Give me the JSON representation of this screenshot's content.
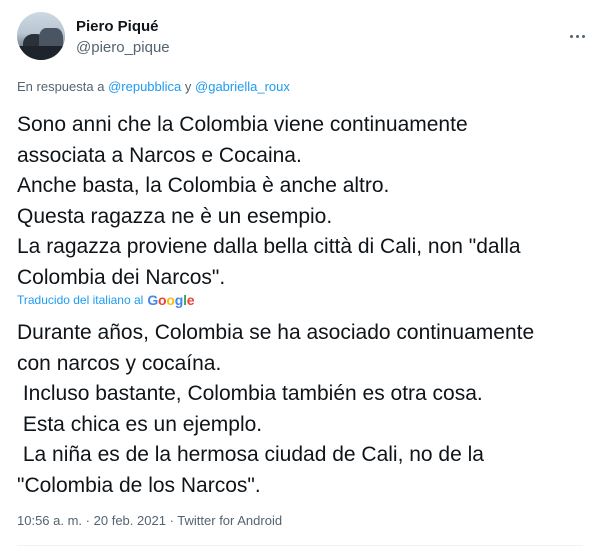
{
  "author": {
    "name": "Piero Piqué",
    "handle": "@piero_pique"
  },
  "reply": {
    "prefix": "En respuesta a",
    "mention1": "@repubblica",
    "conjunction": "y",
    "mention2": "@gabriella_roux"
  },
  "tweet": {
    "lines": [
      "Sono anni che la Colombia viene continuamente",
      "associata a Narcos e Cocaina.",
      "Anche basta, la Colombia è anche altro.",
      "Questa ragazza ne è un esempio.",
      "La ragazza proviene dalla bella città di Cali, non \"dalla",
      "Colombia dei Narcos\"."
    ]
  },
  "translation": {
    "label": "Traducido del italiano al",
    "provider": "Google",
    "lines": [
      "Durante años, Colombia se ha asociado continuamente",
      "con narcos y cocaína.",
      " Incluso bastante, Colombia también es otra cosa.",
      " Esta chica es un ejemplo.",
      " La niña es de la hermosa ciudad de Cali, no de la",
      "\"Colombia de los Narcos\"."
    ]
  },
  "meta": {
    "time": "10:56 a. m.",
    "separator": "·",
    "date": "20 feb. 2021",
    "source": "Twitter for Android"
  },
  "colors": {
    "link": "#1d9bf0",
    "secondary_text": "#536471",
    "primary_text": "#0f1419"
  },
  "icons": {
    "more": "more-horizontal-icon",
    "google": "google-logo"
  }
}
